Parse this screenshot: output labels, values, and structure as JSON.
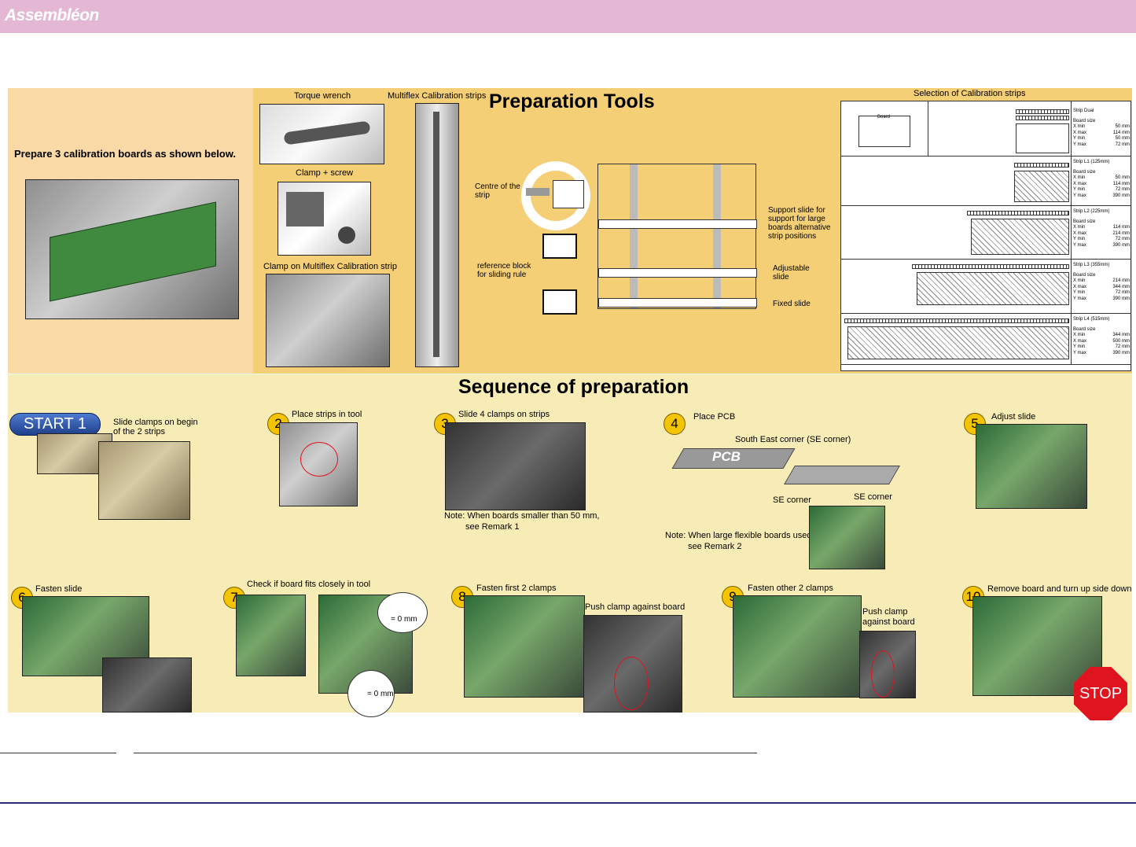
{
  "header": {
    "brand": "Assembléon",
    "color": "#e4b8d4"
  },
  "left_panel": {
    "instruction": "Prepare 3 calibration boards as shown below."
  },
  "tools": {
    "title": "Preparation Tools",
    "torque_wrench": "Torque wrench",
    "clamp_screw": "Clamp + screw",
    "clamp_on_strip": "Clamp on Multiflex Calibration strip",
    "calibration_strips": "Multiflex Calibration strips",
    "centre_strip": "Centre of the strip",
    "reference_block": "reference block for sliding rule",
    "support_slide": "Support slide for support for large boards alternative strip positions",
    "adjustable_slide": "Adjustable slide",
    "fixed_slide": "Fixed slide"
  },
  "selection": {
    "title": "Selection of Calibration strips",
    "board_label": "Board",
    "rows": [
      {
        "name": "Strip Dual",
        "size": "",
        "specs": [
          [
            "X min",
            "50 mm"
          ],
          [
            "X max",
            "114 mm"
          ],
          [
            "Y min",
            "50 mm"
          ],
          [
            "Y max",
            "72 mm"
          ]
        ]
      },
      {
        "name": "Strip L1",
        "size": "(125mm)",
        "specs": [
          [
            "X min",
            "50 mm"
          ],
          [
            "X max",
            "114 mm"
          ],
          [
            "Y min",
            "72 mm"
          ],
          [
            "Y max",
            "390 mm"
          ]
        ]
      },
      {
        "name": "Strip L2",
        "size": "(225mm)",
        "specs": [
          [
            "X min",
            "114 mm"
          ],
          [
            "X max",
            "214 mm"
          ],
          [
            "Y min",
            "72 mm"
          ],
          [
            "Y max",
            "390 mm"
          ]
        ]
      },
      {
        "name": "Strip L3",
        "size": "(355mm)",
        "specs": [
          [
            "X min",
            "214 mm"
          ],
          [
            "X max",
            "344 mm"
          ],
          [
            "Y min",
            "72 mm"
          ],
          [
            "Y max",
            "390 mm"
          ]
        ]
      },
      {
        "name": "Strip L4",
        "size": "(515mm)",
        "specs": [
          [
            "X min",
            "344 mm"
          ],
          [
            "X max",
            "500 mm"
          ],
          [
            "Y min",
            "72 mm"
          ],
          [
            "Y max",
            "390 mm"
          ]
        ]
      }
    ],
    "board_size_label": "Board size"
  },
  "sequence": {
    "title": "Sequence of preparation",
    "start_label": "START 1",
    "stop_label": "STOP",
    "steps": [
      {
        "num": "2",
        "text": "Place strips in tool"
      },
      {
        "num": "3",
        "text": "Slide 4 clamps on strips"
      },
      {
        "num": "4",
        "text": "Place PCB"
      },
      {
        "num": "5",
        "text": "Adjust slide"
      },
      {
        "num": "6",
        "text": "Fasten slide"
      },
      {
        "num": "7",
        "text": "Check  if  board fits closely in tool"
      },
      {
        "num": "8",
        "text": "Fasten first 2 clamps"
      },
      {
        "num": "9",
        "text": "Fasten other 2 clamps"
      },
      {
        "num": "10",
        "text": "Remove board and turn up side down"
      }
    ],
    "step1_text": "Slide clamps on begin of the 2 strips",
    "note3_line1": "Note: When boards smaller than 50 mm,",
    "note3_line2": "see Remark 1",
    "note4_line1": "Note: When large flexible boards used,",
    "note4_line2": "see Remark 2",
    "se_corner_full": "South East corner (SE corner)",
    "se_corner": "SE corner",
    "pcb_label": "PCB",
    "push_clamp": "Push clamp against board",
    "push_clamp2_line1": "Push clamp",
    "push_clamp2_line2": "against board",
    "zero_mm": "= 0 mm"
  }
}
